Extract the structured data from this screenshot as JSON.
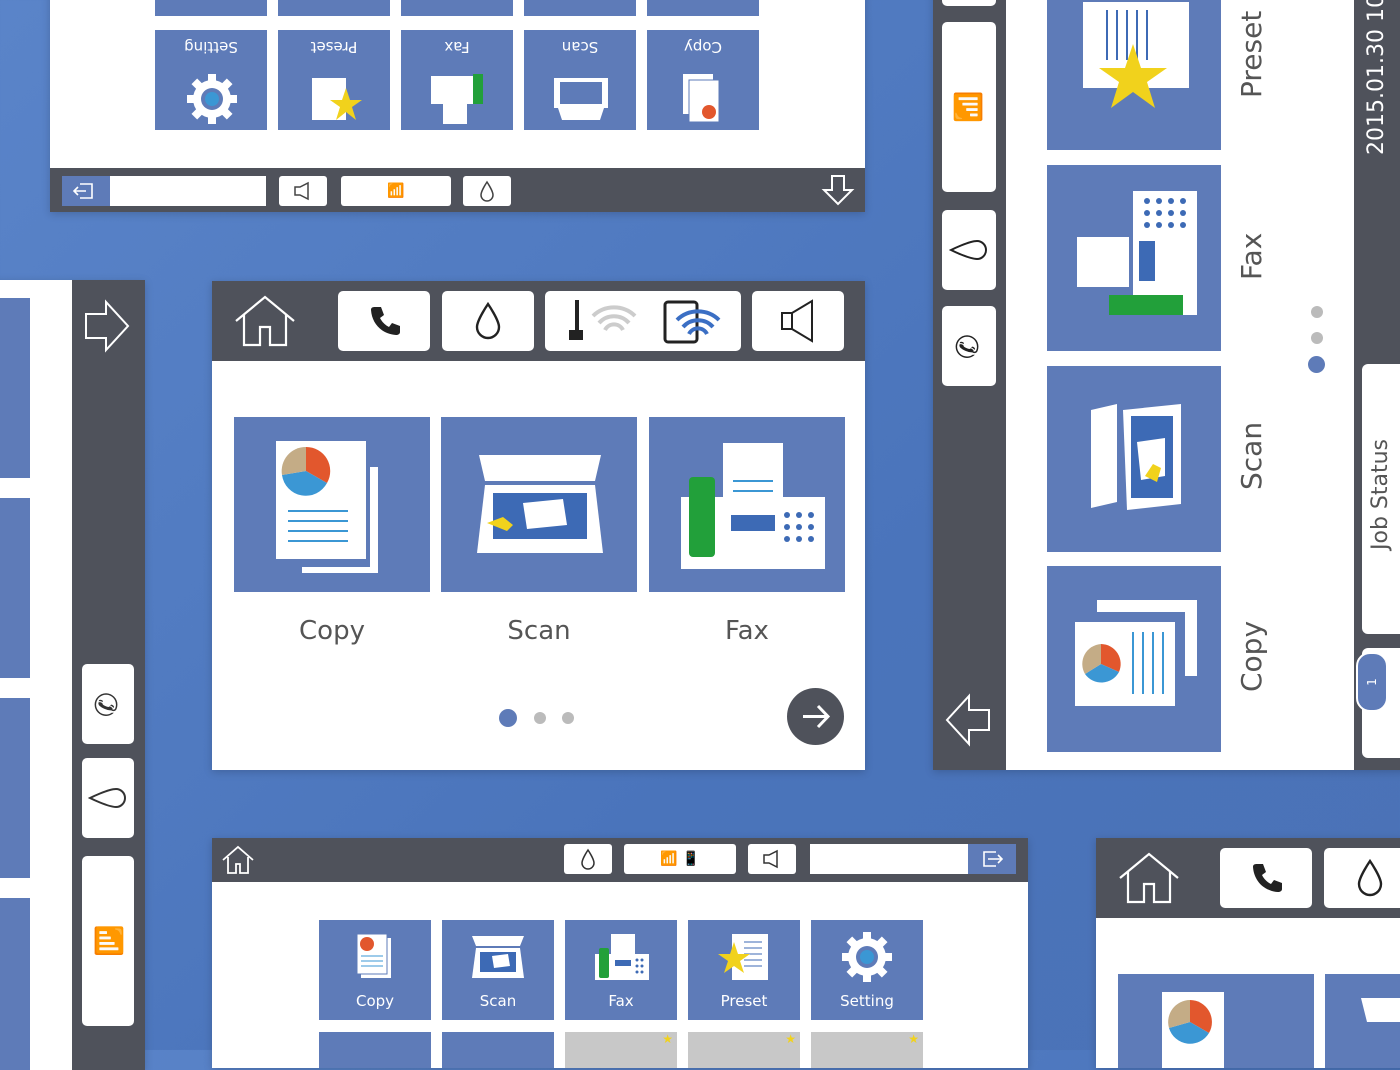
{
  "main": {
    "apps": [
      {
        "label": "Copy"
      },
      {
        "label": "Scan"
      },
      {
        "label": "Fax"
      }
    ],
    "page_dots": 3,
    "active_page": 1
  },
  "top_left": {
    "apps_rotated": [
      "Setting",
      "Preset",
      "Fax",
      "Scan",
      "Copy"
    ]
  },
  "bottom": {
    "apps": [
      "Copy",
      "Scan",
      "Fax",
      "Preset",
      "Setting"
    ]
  },
  "right": {
    "apps": [
      "Preset",
      "Fax",
      "Scan",
      "Copy"
    ],
    "date": "2015.01.30 10",
    "job_status": "Job Status",
    "job_count": "1"
  },
  "colors": {
    "accent": "#5e7bb8",
    "dark_bar": "#4f525b",
    "green": "#22a03a",
    "star": "#f1d21c",
    "pie_red": "#e2572d",
    "pie_blue": "#3b97d4",
    "pie_tan": "#c4ac86"
  }
}
